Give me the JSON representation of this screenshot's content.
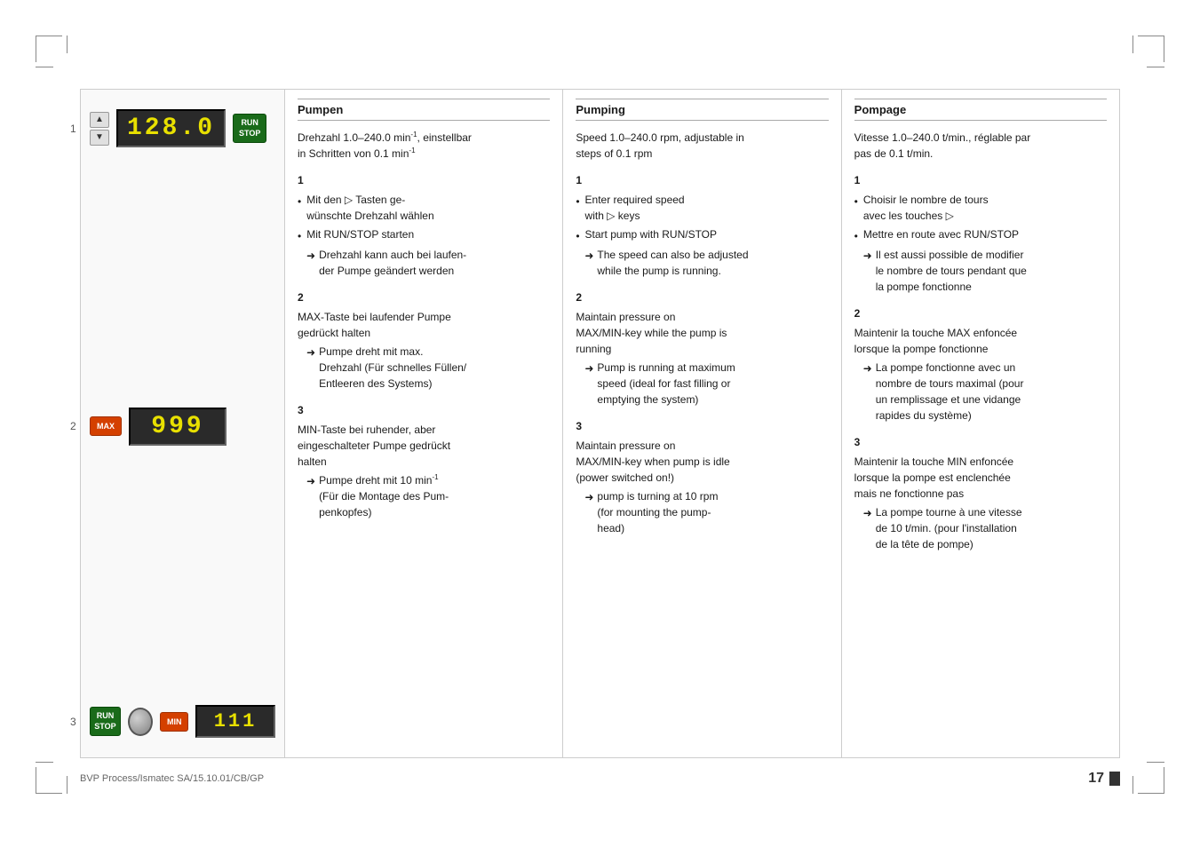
{
  "page": {
    "footer_left": "BVP Process/Ismatec SA/15.10.01/CB/GP",
    "page_number": "17"
  },
  "device_rows": [
    {
      "number": "1",
      "lcd": "128.0",
      "has_arrows": true,
      "has_run_stop": true,
      "has_max": false,
      "has_min": false,
      "has_knob": false
    },
    {
      "number": "2",
      "lcd": "999",
      "has_arrows": false,
      "has_run_stop": false,
      "has_max": true,
      "has_min": false,
      "has_knob": false
    },
    {
      "number": "3",
      "lcd": "111",
      "has_arrows": false,
      "has_run_stop": true,
      "has_max": false,
      "has_min": true,
      "has_knob": true
    }
  ],
  "columns": {
    "german": {
      "header": "Pumpen",
      "subtitle": "Drehzahl 1.0–240.0 min⁻¹, einstellbar\nin Schritten von 0.1 min⁻¹",
      "sections": [
        {
          "num": "1",
          "bullets": [
            {
              "type": "bullet",
              "text": "Mit den △∇ Tasten ge-\nwünschte Drehzahl wählen"
            },
            {
              "type": "bullet",
              "text": "Mit RUN/STOP starten"
            },
            {
              "type": "arrow",
              "text": "Drehzahl kann auch bei laufen-\nder Pumpe geändert werden"
            }
          ]
        },
        {
          "num": "2",
          "bullets": [
            {
              "type": "plain",
              "text": "MAX-Taste bei laufender Pumpe\ngedrückt halten"
            },
            {
              "type": "arrow",
              "text": "Pumpe dreht mit max.\nDrehzahl  (Für schnelles Füllen/\nEntleeren des Systems)"
            }
          ]
        },
        {
          "num": "3",
          "bullets": [
            {
              "type": "plain",
              "text": "MIN-Taste bei ruhender, aber\neingeschalteter Pumpe gedrückt\nhalten"
            },
            {
              "type": "arrow",
              "text": "Pumpe dreht mit 10 min⁻¹\n(Für die Montage des Pum-\npenkopfes)"
            }
          ]
        }
      ]
    },
    "english": {
      "header": "Pumping",
      "subtitle": "Speed 1.0–240.0 rpm, adjustable in\nsteps of 0.1 rpm",
      "sections": [
        {
          "num": "1",
          "bullets": [
            {
              "type": "bullet",
              "text": "Enter required speed\nwith △∇ keys"
            },
            {
              "type": "bullet",
              "text": "Start pump with RUN/STOP"
            },
            {
              "type": "arrow",
              "text": "The speed can also be adjusted\nwhile the pump is running."
            }
          ]
        },
        {
          "num": "2",
          "bullets": [
            {
              "type": "plain",
              "text": "Maintain pressure on\nMAX/MIN-key while the pump is\nrunning"
            },
            {
              "type": "arrow",
              "text": "Pump is running at maximum\nspeed (ideal for fast filling or\nemptying the system)"
            }
          ]
        },
        {
          "num": "3",
          "bullets": [
            {
              "type": "plain",
              "text": "Maintain pressure on\nMAX/MIN-key when pump is idle\n(power switched on!)"
            },
            {
              "type": "arrow",
              "text": "pump is turning at 10 rpm\n(for mounting the pump-\nhead)"
            }
          ]
        }
      ]
    },
    "french": {
      "header": "Pompage",
      "subtitle": "Vitesse 1.0–240.0 t/min., réglable par\npas de 0.1 t/min.",
      "sections": [
        {
          "num": "1",
          "bullets": [
            {
              "type": "bullet",
              "text": "Choisir le nombre de tours\navec les touches △∇"
            },
            {
              "type": "bullet",
              "text": "Mettre en route avec RUN/STOP"
            },
            {
              "type": "arrow",
              "text": "Il est aussi possible de modifier\nle nombre de tours pendant que\nla pompe fonctionne"
            }
          ]
        },
        {
          "num": "2",
          "bullets": [
            {
              "type": "plain",
              "text": "Maintenir la touche MAX enfoncée\nlorsque la pompe fonctionne"
            },
            {
              "type": "arrow",
              "text": "La pompe fonctionne avec un\nnombre de tours maximal (pour\nun remplissage et une vidange\nrapides du système)"
            }
          ]
        },
        {
          "num": "3",
          "bullets": [
            {
              "type": "plain",
              "text": "Maintenir la touche MIN enfoncée\nlorsque la pompe est enclenchée\nmais ne fonctionne pas"
            },
            {
              "type": "arrow",
              "text": "La pompe tourne à une vitesse\nde 10 t/min. (pour l’installation\nde la tête de pompe)"
            }
          ]
        }
      ]
    }
  }
}
